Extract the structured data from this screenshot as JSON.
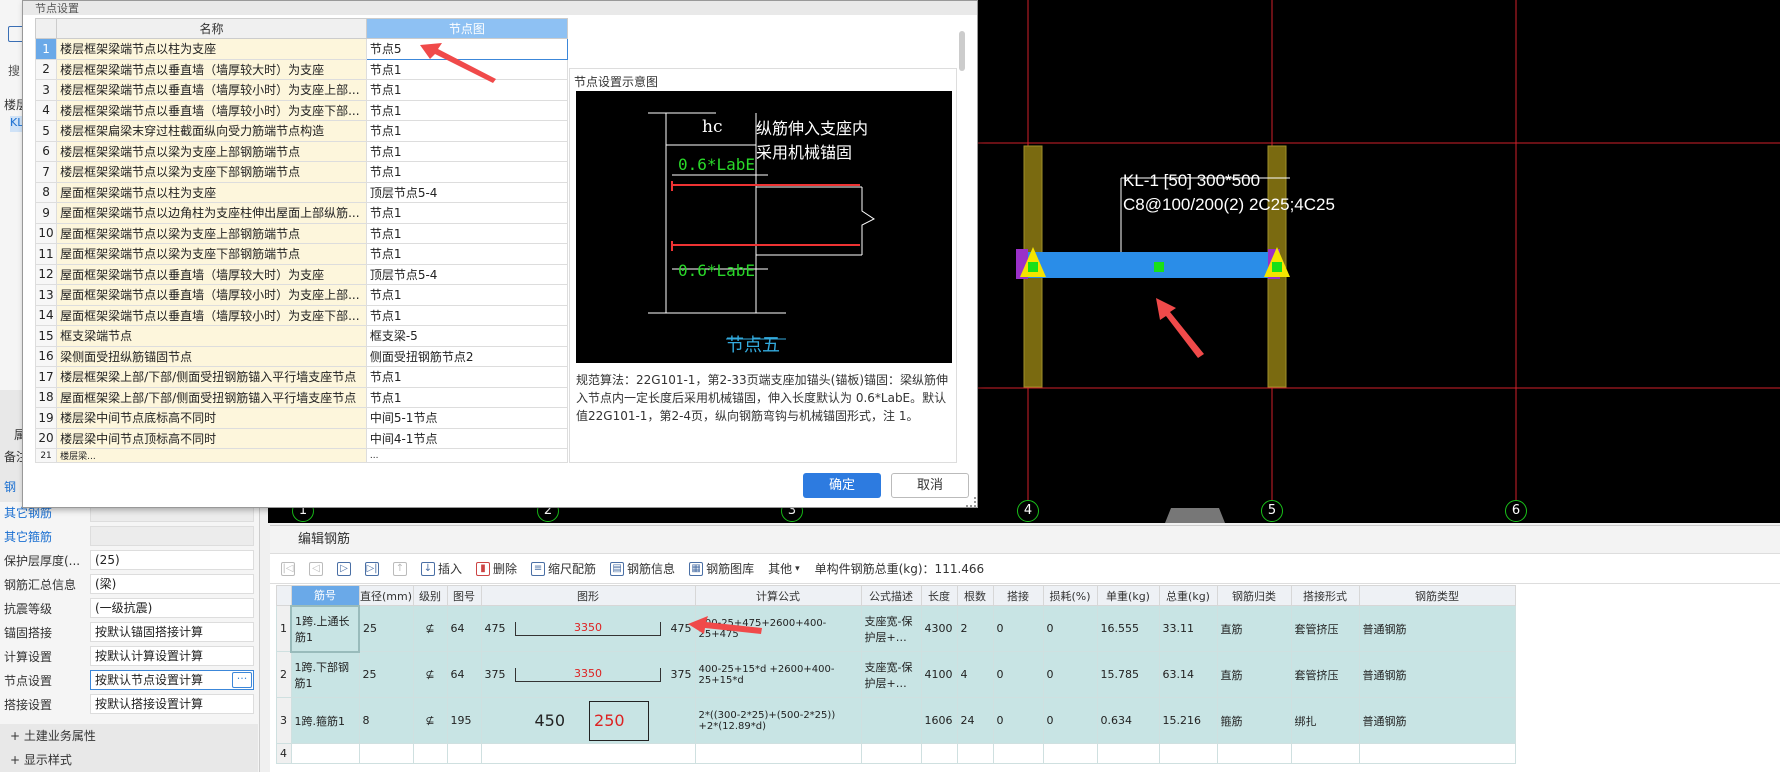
{
  "dialog": {
    "title": "节点设置",
    "col_name": "名称",
    "col_diagram": "节点图",
    "rows": [
      {
        "num": "1",
        "name": "楼层框架梁端节点以柱为支座",
        "value": "节点5"
      },
      {
        "num": "2",
        "name": "楼层框架梁端节点以垂直墙（墙厚较大时）为支座",
        "value": "节点1"
      },
      {
        "num": "3",
        "name": "楼层框架梁端节点以垂直墙（墙厚较小时）为支座上部...",
        "value": "节点1"
      },
      {
        "num": "4",
        "name": "楼层框架梁端节点以垂直墙（墙厚较小时）为支座下部...",
        "value": "节点1"
      },
      {
        "num": "5",
        "name": "楼层框架扁梁末穿过柱截面纵向受力筋端节点构造",
        "value": "节点1"
      },
      {
        "num": "6",
        "name": "楼层框架梁端节点以梁为支座上部钢筋端节点",
        "value": "节点1"
      },
      {
        "num": "7",
        "name": "楼层框架梁端节点以梁为支座下部钢筋端节点",
        "value": "节点1"
      },
      {
        "num": "8",
        "name": "屋面框架梁端节点以柱为支座",
        "value": "顶层节点5-4"
      },
      {
        "num": "9",
        "name": "屋面框架梁端节点以边角柱为支座柱伸出屋面上部纵筋...",
        "value": "节点1"
      },
      {
        "num": "10",
        "name": "屋面框架梁端节点以梁为支座上部钢筋端节点",
        "value": "节点1"
      },
      {
        "num": "11",
        "name": "屋面框架梁端节点以梁为支座下部钢筋端节点",
        "value": "节点1"
      },
      {
        "num": "12",
        "name": "屋面框架梁端节点以垂直墙（墙厚较大时）为支座",
        "value": "顶层节点5-4"
      },
      {
        "num": "13",
        "name": "屋面框架梁端节点以垂直墙（墙厚较小时）为支座上部...",
        "value": "节点1"
      },
      {
        "num": "14",
        "name": "屋面框架梁端节点以垂直墙（墙厚较小时）为支座下部...",
        "value": "节点1"
      },
      {
        "num": "15",
        "name": "框支梁端节点",
        "value": "框支梁-5"
      },
      {
        "num": "16",
        "name": "梁侧面受扭纵筋锚固节点",
        "value": "侧面受扭钢筋节点2"
      },
      {
        "num": "17",
        "name": "楼层框架梁上部/下部/侧面受扭钢筋锚入平行墙支座节点",
        "value": "节点1"
      },
      {
        "num": "18",
        "name": "屋面框架梁上部/下部/侧面受扭钢筋锚入平行墙支座节点",
        "value": "节点1"
      },
      {
        "num": "19",
        "name": "楼层梁中间节点底标高不同时",
        "value": "中间5-1节点"
      },
      {
        "num": "20",
        "name": "楼层梁中间节点顶标高不同时",
        "value": "中间4-1节点"
      },
      {
        "num": "21",
        "name": "楼层梁...",
        "value": "..."
      }
    ],
    "preview_title": "节点设置示意图",
    "diagram": {
      "hc": "hc",
      "note1": "纵筋伸入支座内",
      "note2": "采用机械锚固",
      "dim_top": "0.6*LabE",
      "dim_bottom": "0.6*LabE",
      "caption": "节点五"
    },
    "rule_text": "规范算法：22G101-1，第2-33页端支座加锚头(锚板)锚固：梁纵筋伸入节点内一定长度后采用机械锚固，伸入长度默认为 0.6*LabE。默认值22G101-1，第2-4页，纵向钢筋弯钩与机械锚固形式，注 1。",
    "ok_label": "确定",
    "cancel_label": "取消"
  },
  "left_panel": {
    "rows": [
      {
        "name": "其它钢筋",
        "value": "",
        "blue": true
      },
      {
        "name": "其它箍筋",
        "value": "",
        "blue": true
      },
      {
        "name": "保护层厚度(...",
        "value": "(25)",
        "blue": false
      },
      {
        "name": "钢筋汇总信息",
        "value": "(梁)",
        "blue": false
      },
      {
        "name": "抗震等级",
        "value": "(一级抗震)",
        "blue": false
      },
      {
        "name": "锚固搭接",
        "value": "按默认锚固搭接计算",
        "blue": false
      },
      {
        "name": "计算设置",
        "value": "按默认计算设置计算",
        "blue": false
      },
      {
        "name": "节点设置",
        "value": "按默认节点设置计算",
        "blue": false
      },
      {
        "name": "搭接设置",
        "value": "按默认搭接设置计算",
        "blue": false
      }
    ],
    "sections": [
      "土建业务属性",
      "显示样式"
    ],
    "partial": [
      "搜",
      "楼层",
      "KL",
      "属",
      "备注",
      "钢"
    ]
  },
  "cad": {
    "beam_label_1": "KL-1 [50] 300*500",
    "beam_label_2": "C8@100/200(2) 2C25;4C25",
    "axes": [
      "1",
      "2",
      "3",
      "4",
      "5",
      "6"
    ]
  },
  "editor": {
    "title": "编辑钢筋",
    "toolbar": [
      "插入",
      "删除",
      "缩尺配筋",
      "钢筋信息",
      "钢筋图库",
      "其他"
    ],
    "total_label": "单构件钢筋总重(kg)：111.466",
    "headers": [
      "筋号",
      "直径(mm)",
      "级别",
      "图号",
      "图形",
      "计算公式",
      "公式描述",
      "长度",
      "根数",
      "搭接",
      "损耗(%)",
      "单重(kg)",
      "总重(kg)",
      "钢筋归类",
      "搭接形式",
      "钢筋类型"
    ],
    "rows": [
      {
        "idx": "1",
        "name": "1跨.上通长筋1",
        "dia": "25",
        "grade": "⊈",
        "fig": "64",
        "left": "475",
        "mid": "3350",
        "right": "475",
        "formula": "400-25+475+2600+400-25+475",
        "desc": "支座宽-保护层+…",
        "len": "4300",
        "count": "2",
        "lap": "0",
        "loss": "0",
        "unit": "16.555",
        "total": "33.11",
        "cat": "直筋",
        "lapform": "套管挤压",
        "type": "普通钢筋"
      },
      {
        "idx": "2",
        "name": "1跨.下部钢筋1",
        "dia": "25",
        "grade": "⊈",
        "fig": "64",
        "left": "375",
        "mid": "3350",
        "right": "375",
        "formula": "400-25+15*d +2600+400-25+15*d",
        "desc": "支座宽-保护层+…",
        "len": "4100",
        "count": "4",
        "lap": "0",
        "loss": "0",
        "unit": "15.785",
        "total": "63.14",
        "cat": "直筋",
        "lapform": "套管挤压",
        "type": "普通钢筋"
      },
      {
        "idx": "3",
        "name": "1跨.箍筋1",
        "dia": "8",
        "grade": "⊈",
        "fig": "195",
        "left": "450",
        "mid": "250",
        "right": "",
        "formula": "2*((300-2*25)+(500-2*25)) +2*(12.89*d)",
        "desc": "",
        "len": "1606",
        "count": "24",
        "lap": "0",
        "loss": "0",
        "unit": "0.634",
        "total": "15.216",
        "cat": "箍筋",
        "lapform": "绑扎",
        "type": "普通钢筋"
      }
    ],
    "empty_idx": "4"
  },
  "colors": {
    "accent": "#2d7be0",
    "teal_row": "#c8e4e4",
    "cad_red": "#e0202a",
    "beam_blue": "#2a8de8"
  }
}
